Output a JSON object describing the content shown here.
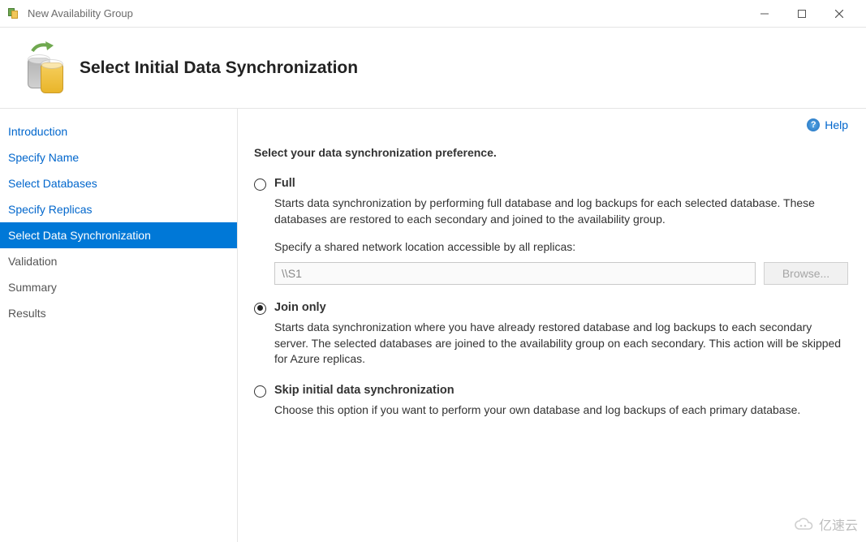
{
  "window": {
    "title": "New Availability Group"
  },
  "header": {
    "title": "Select Initial Data Synchronization"
  },
  "help": {
    "label": "Help"
  },
  "nav": [
    {
      "label": "Introduction",
      "state": "done"
    },
    {
      "label": "Specify Name",
      "state": "done"
    },
    {
      "label": "Select Databases",
      "state": "done"
    },
    {
      "label": "Specify Replicas",
      "state": "done"
    },
    {
      "label": "Select Data Synchronization",
      "state": "active"
    },
    {
      "label": "Validation",
      "state": "after"
    },
    {
      "label": "Summary",
      "state": "after"
    },
    {
      "label": "Results",
      "state": "after"
    }
  ],
  "main": {
    "prompt": "Select your data synchronization preference.",
    "options": {
      "full": {
        "title": "Full",
        "description": "Starts data synchronization by performing full database and log backups for each selected database. These databases are restored to each secondary and joined to the availability group.",
        "shareLabel": "Specify a shared network location accessible by all replicas:",
        "shareValue": "\\\\S1",
        "browseLabel": "Browse..."
      },
      "join": {
        "title": "Join only",
        "description": "Starts data synchronization where you have already restored database and log backups to each secondary server. The selected databases are joined to the availability group on each secondary. This action will be skipped for Azure replicas."
      },
      "skip": {
        "title": "Skip initial data synchronization",
        "description": "Choose this option if you want to perform your own database and log backups of each primary database."
      }
    },
    "selected": "join"
  },
  "watermark": {
    "text": "亿速云"
  }
}
